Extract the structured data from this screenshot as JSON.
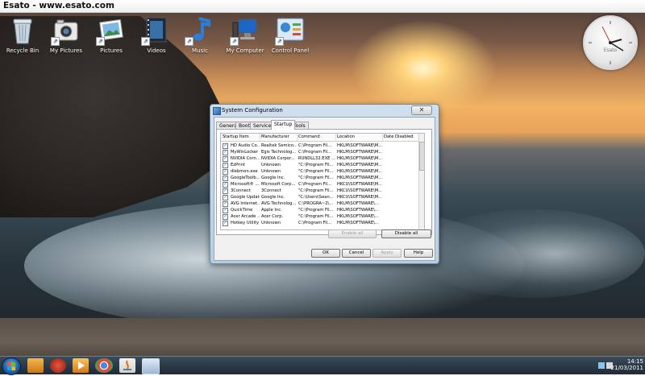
{
  "window_title": "Esato - www.esato.com",
  "desktop_icons": [
    {
      "label": "Recycle Bin",
      "icon": "recycle-bin-icon"
    },
    {
      "label": "My Pictures",
      "icon": "camera-icon"
    },
    {
      "label": "Pictures",
      "icon": "pictures-icon"
    },
    {
      "label": "Videos",
      "icon": "videos-icon"
    },
    {
      "label": "Music",
      "icon": "music-note-icon"
    },
    {
      "label": "My Computer",
      "icon": "computer-icon"
    },
    {
      "label": "Control Panel",
      "icon": "control-panel-icon"
    }
  ],
  "clock_gadget": {
    "brand": "Esato"
  },
  "dialog": {
    "title": "System Configuration",
    "close_label": "✕",
    "tabs": [
      "General",
      "Boot",
      "Services",
      "Startup",
      "Tools"
    ],
    "selected_tab": "Startup",
    "columns": [
      "Startup Item",
      "Manufacturer",
      "Command",
      "Location",
      "Date Disabled"
    ],
    "rows": [
      {
        "item": "HD Audio Co...",
        "manufacturer": "Realtek Semico...",
        "command": "C:\\Program Fil...",
        "location": "HKLM\\SOFTWARE\\M...",
        "checked": true
      },
      {
        "item": "MyWinLocker",
        "manufacturer": "Egis Technolog...",
        "command": "C:\\Program Fil...",
        "location": "HKLM\\SOFTWARE\\M...",
        "checked": true
      },
      {
        "item": "NVIDIA Corn...",
        "manufacturer": "NVIDIA Corpor...",
        "command": "RUNDLL32.EXE ...",
        "location": "HKLM\\SOFTWARE\\M...",
        "checked": true
      },
      {
        "item": "EzPrint",
        "manufacturer": "Unknown",
        "command": "\"C:\\Program Fil...",
        "location": "HKLM\\SOFTWARE\\M...",
        "checked": true
      },
      {
        "item": "dlebmon.exe",
        "manufacturer": "Unknown",
        "command": "\"C:\\Program Fil...",
        "location": "HKLM\\SOFTWARE\\M...",
        "checked": true
      },
      {
        "item": "GoogleToolb...",
        "manufacturer": "Google Inc.",
        "command": "\"C:\\Program Fil...",
        "location": "HKLM\\SOFTWARE\\M...",
        "checked": true
      },
      {
        "item": "Microsoft® ...",
        "manufacturer": "Microsoft Corp...",
        "command": "C:\\Program Fil...",
        "location": "HKCU\\SOFTWARE\\M...",
        "checked": true
      },
      {
        "item": "3Connect",
        "manufacturer": "3Connect",
        "command": "\"C:\\Program Fil...",
        "location": "HKCU\\SOFTWARE\\M...",
        "checked": true
      },
      {
        "item": "Google Update",
        "manufacturer": "Google Inc.",
        "command": "\"C:\\Users\\Sean...",
        "location": "HKCU\\SOFTWARE\\M...",
        "checked": true
      },
      {
        "item": "AVG Internet...",
        "manufacturer": "AVG Technolog...",
        "command": "C:\\PROGRA~2\\...",
        "location": "HKLM\\SOFTWARE\\...",
        "checked": true
      },
      {
        "item": "QuickTime",
        "manufacturer": "Apple Inc.",
        "command": "\"C:\\Program Fil...",
        "location": "HKLM\\SOFTWARE\\...",
        "checked": true
      },
      {
        "item": "Acer Arcade ...",
        "manufacturer": "Acer Corp.",
        "command": "\"C:\\Program Fil...",
        "location": "HKLM\\SOFTWARE\\...",
        "checked": true
      },
      {
        "item": "Hotkey Utility",
        "manufacturer": "Unknown",
        "command": "C:\\Program Fil...",
        "location": "HKLM\\SOFTWARE\\...",
        "checked": true
      }
    ],
    "enable_all": "Enable all",
    "disable_all": "Disable all",
    "ok": "OK",
    "cancel": "Cancel",
    "apply": "Apply",
    "help": "Help"
  },
  "taskbar": {
    "apps": [
      "start-orb",
      "folder-icon",
      "media-icon",
      "player-icon",
      "chrome-icon",
      "java-icon",
      "msconfig-icon"
    ],
    "time": "14:15",
    "date": "21/03/2011"
  }
}
